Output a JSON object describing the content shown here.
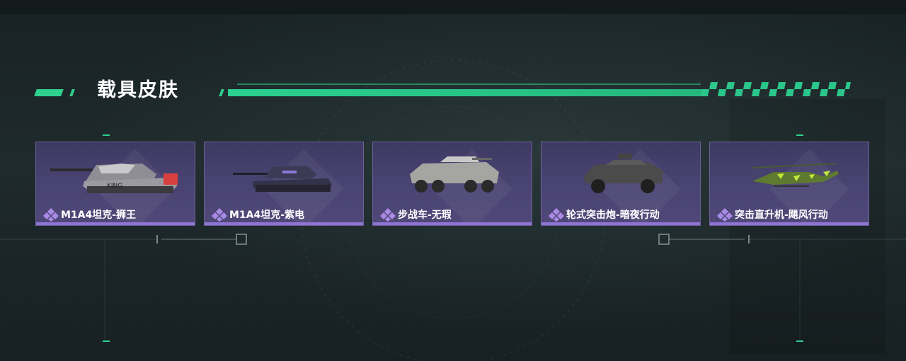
{
  "section": {
    "title": "载具皮肤"
  },
  "colors": {
    "accent": "#2fd18e",
    "card_bg": "#463f6e",
    "card_border": "#6a6399",
    "rarity_bar": "#8f74d4"
  },
  "cards": [
    {
      "name": "M1A4坦克-狮王",
      "vehicle_icon": "tank-icon",
      "rarity_icon": "purple-diamond-icon"
    },
    {
      "name": "M1A4坦克-紫电",
      "vehicle_icon": "tank-icon",
      "rarity_icon": "purple-diamond-icon"
    },
    {
      "name": "步战车-无瑕",
      "vehicle_icon": "ifv-icon",
      "rarity_icon": "purple-diamond-icon"
    },
    {
      "name": "轮式突击炮-暗夜行动",
      "vehicle_icon": "armored-car-icon",
      "rarity_icon": "purple-diamond-icon"
    },
    {
      "name": "突击直升机-飓风行动",
      "vehicle_icon": "helicopter-icon",
      "rarity_icon": "purple-diamond-icon"
    }
  ]
}
